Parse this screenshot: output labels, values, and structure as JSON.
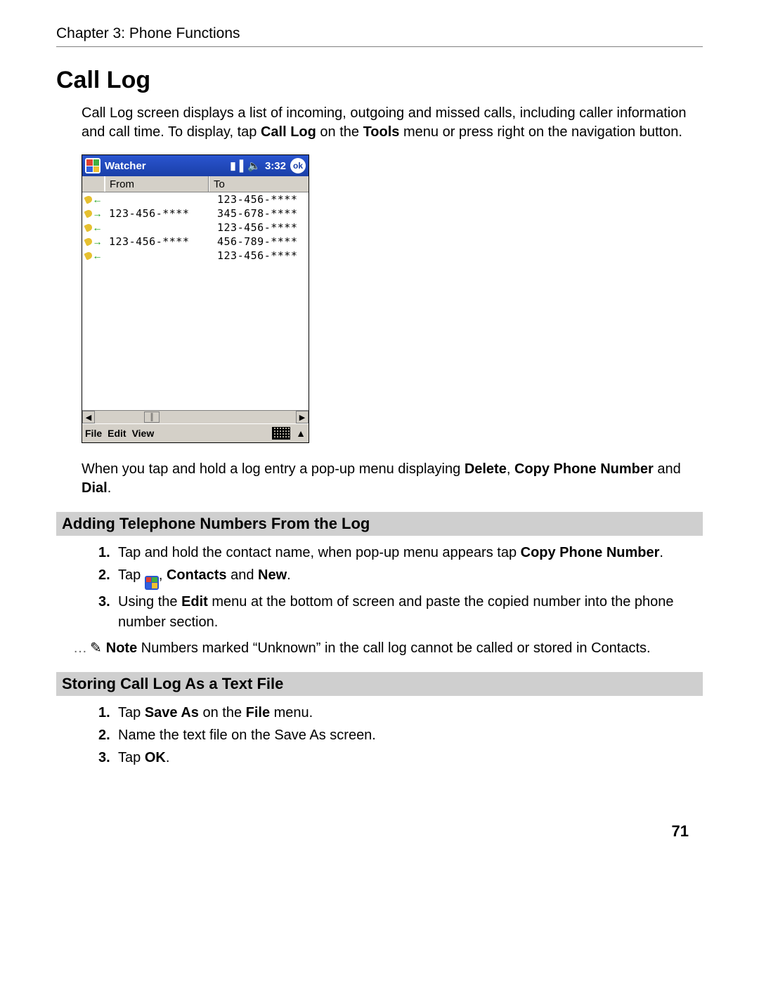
{
  "header": {
    "chapter_line": "Chapter 3: Phone Functions",
    "title": "Call Log",
    "page_number": "71"
  },
  "intro": {
    "t1": "Call Log screen displays a list of incoming, outgoing and missed calls, including caller information and call time. To display, tap ",
    "b1": "Call Log",
    "t2": " on the ",
    "b2": "Tools",
    "t3": " menu or press right on the navigation button."
  },
  "pda": {
    "app_name": "Watcher",
    "time": "3:32",
    "ok": "ok",
    "col_from": "From",
    "col_to": "To",
    "rows": [
      {
        "dir": "in",
        "from": "",
        "to": "123-456-****"
      },
      {
        "dir": "out",
        "from": "123-456-****",
        "to": "345-678-****"
      },
      {
        "dir": "in",
        "from": "",
        "to": "123-456-****"
      },
      {
        "dir": "out",
        "from": "123-456-****",
        "to": "456-789-****"
      },
      {
        "dir": "in",
        "from": "",
        "to": "123-456-****"
      }
    ],
    "menu_file": "File",
    "menu_edit": "Edit",
    "menu_view": "View"
  },
  "after_pda": {
    "t1": "When you tap and hold a log entry a pop-up menu displaying ",
    "b1": "Delete",
    "t2": ", ",
    "b2": "Copy Phone Number",
    "t3": " and ",
    "b3": "Dial",
    "t4": "."
  },
  "section_add": {
    "title": "Adding Telephone Numbers From the Log",
    "s1": {
      "num": "1.",
      "t1": "Tap and hold the contact name, when pop-up menu appears tap ",
      "b1": "Copy Phone Number",
      "t2": "."
    },
    "s2": {
      "num": "2.",
      "t1": "Tap ",
      "t2": ", ",
      "b1": "Contacts",
      "t3": " and ",
      "b2": "New",
      "t4": "."
    },
    "s3": {
      "num": "3.",
      "t1": "Using the ",
      "b1": "Edit",
      "t2": " menu at the bottom of screen and paste the copied number into the phone number section."
    },
    "note_label": "Note",
    "note_text": "  Numbers marked “Unknown” in the call log cannot be called or stored in Contacts."
  },
  "section_store": {
    "title": "Storing Call Log As a Text File",
    "s1": {
      "num": "1.",
      "t1": "Tap ",
      "b1": "Save As",
      "t2": " on the ",
      "b2": "File",
      "t3": " menu."
    },
    "s2": {
      "num": "2.",
      "t1": "Name the text file on the Save As screen."
    },
    "s3": {
      "num": "3.",
      "t1": "Tap ",
      "b1": "OK",
      "t2": "."
    }
  }
}
